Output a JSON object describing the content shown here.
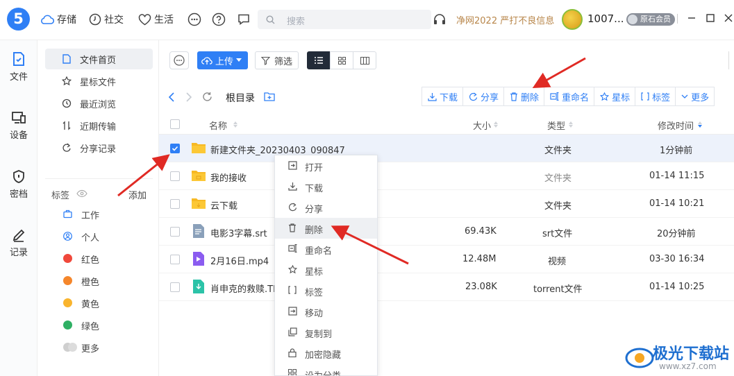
{
  "app": {
    "logo": "5"
  },
  "topnav": [
    {
      "label": "存储",
      "icon": "cloud-icon"
    },
    {
      "label": "社交",
      "icon": "clock-icon"
    },
    {
      "label": "生活",
      "icon": "heart-icon"
    }
  ],
  "search": {
    "placeholder": "搜索"
  },
  "notice": "净网2022 严打不良信息",
  "user": {
    "name": "1007...",
    "badge": "原石会员"
  },
  "leftnav": [
    {
      "label": "文件",
      "icon": "file-icon"
    },
    {
      "label": "设备",
      "icon": "device-icon"
    },
    {
      "label": "密档",
      "icon": "shield-icon"
    },
    {
      "label": "记录",
      "icon": "pen-icon"
    }
  ],
  "sidebar": {
    "items": [
      {
        "label": "文件首页",
        "icon": "doc-icon"
      },
      {
        "label": "星标文件",
        "icon": "star-icon"
      },
      {
        "label": "最近浏览",
        "icon": "history-icon"
      },
      {
        "label": "近期传输",
        "icon": "transfer-icon"
      },
      {
        "label": "分享记录",
        "icon": "share-icon"
      }
    ],
    "tags_header": "标签",
    "tags_add": "添加",
    "tags": [
      {
        "label": "工作",
        "color": "#2f7ff5",
        "type": "briefcase"
      },
      {
        "label": "个人",
        "color": "#2f7ff5",
        "type": "person"
      },
      {
        "label": "红色",
        "color": "#f0483b"
      },
      {
        "label": "橙色",
        "color": "#f5862b"
      },
      {
        "label": "黄色",
        "color": "#f9b42e"
      },
      {
        "label": "绿色",
        "color": "#2fb064"
      },
      {
        "label": "更多",
        "color": "#cfcfcf"
      }
    ]
  },
  "toolbar": {
    "upload": "上传",
    "filter": "筛选"
  },
  "breadcrumb": {
    "root": "根目录"
  },
  "actions": [
    "下载",
    "分享",
    "删除",
    "重命名",
    "星标",
    "标签",
    "更多"
  ],
  "table": {
    "headers": {
      "name": "名称",
      "size": "大小",
      "type": "类型",
      "mtime": "修改时间"
    },
    "rows": [
      {
        "name": "新建文件夹_20230403_090847",
        "size": "",
        "type": "文件夹",
        "mtime": "1分钟前",
        "icon": "folder-icon",
        "selected": true
      },
      {
        "name": "我的接收",
        "size": "",
        "type": "文件夹",
        "mtime": "01-14 11:15",
        "icon": "folder-icon"
      },
      {
        "name": "云下载",
        "size": "",
        "type": "文件夹",
        "mtime": "01-14 10:21",
        "icon": "folder-icon"
      },
      {
        "name": "电影3字幕.srt",
        "size": "69.43K",
        "type": "srt文件",
        "mtime": "20分钟前",
        "icon": "srt-file-icon"
      },
      {
        "name": "2月16日.mp4",
        "size": "12.48M",
        "type": "视频",
        "mtime": "03-30 16:34",
        "icon": "video-file-icon"
      },
      {
        "name": "肖申克的救赎.Tl",
        "size": "23.08K",
        "type": "torrent文件",
        "mtime": "01-14 10:25",
        "icon": "torrent-file-icon"
      }
    ]
  },
  "context_menu": [
    {
      "label": "打开",
      "icon": "open-icon"
    },
    {
      "label": "下载",
      "icon": "download-icon"
    },
    {
      "label": "分享",
      "icon": "share-icon"
    },
    {
      "label": "删除",
      "icon": "trash-icon",
      "highlighted": true
    },
    {
      "label": "重命名",
      "icon": "rename-icon"
    },
    {
      "label": "星标",
      "icon": "star-icon"
    },
    {
      "label": "标签",
      "icon": "tag-icon"
    },
    {
      "label": "移动",
      "icon": "move-icon"
    },
    {
      "label": "复制到",
      "icon": "copy-icon"
    },
    {
      "label": "加密隐藏",
      "icon": "lock-icon"
    },
    {
      "label": "设为分类",
      "icon": "grid-icon"
    }
  ],
  "watermark": {
    "title": "极光下载站",
    "url": "www.xz7.com"
  }
}
